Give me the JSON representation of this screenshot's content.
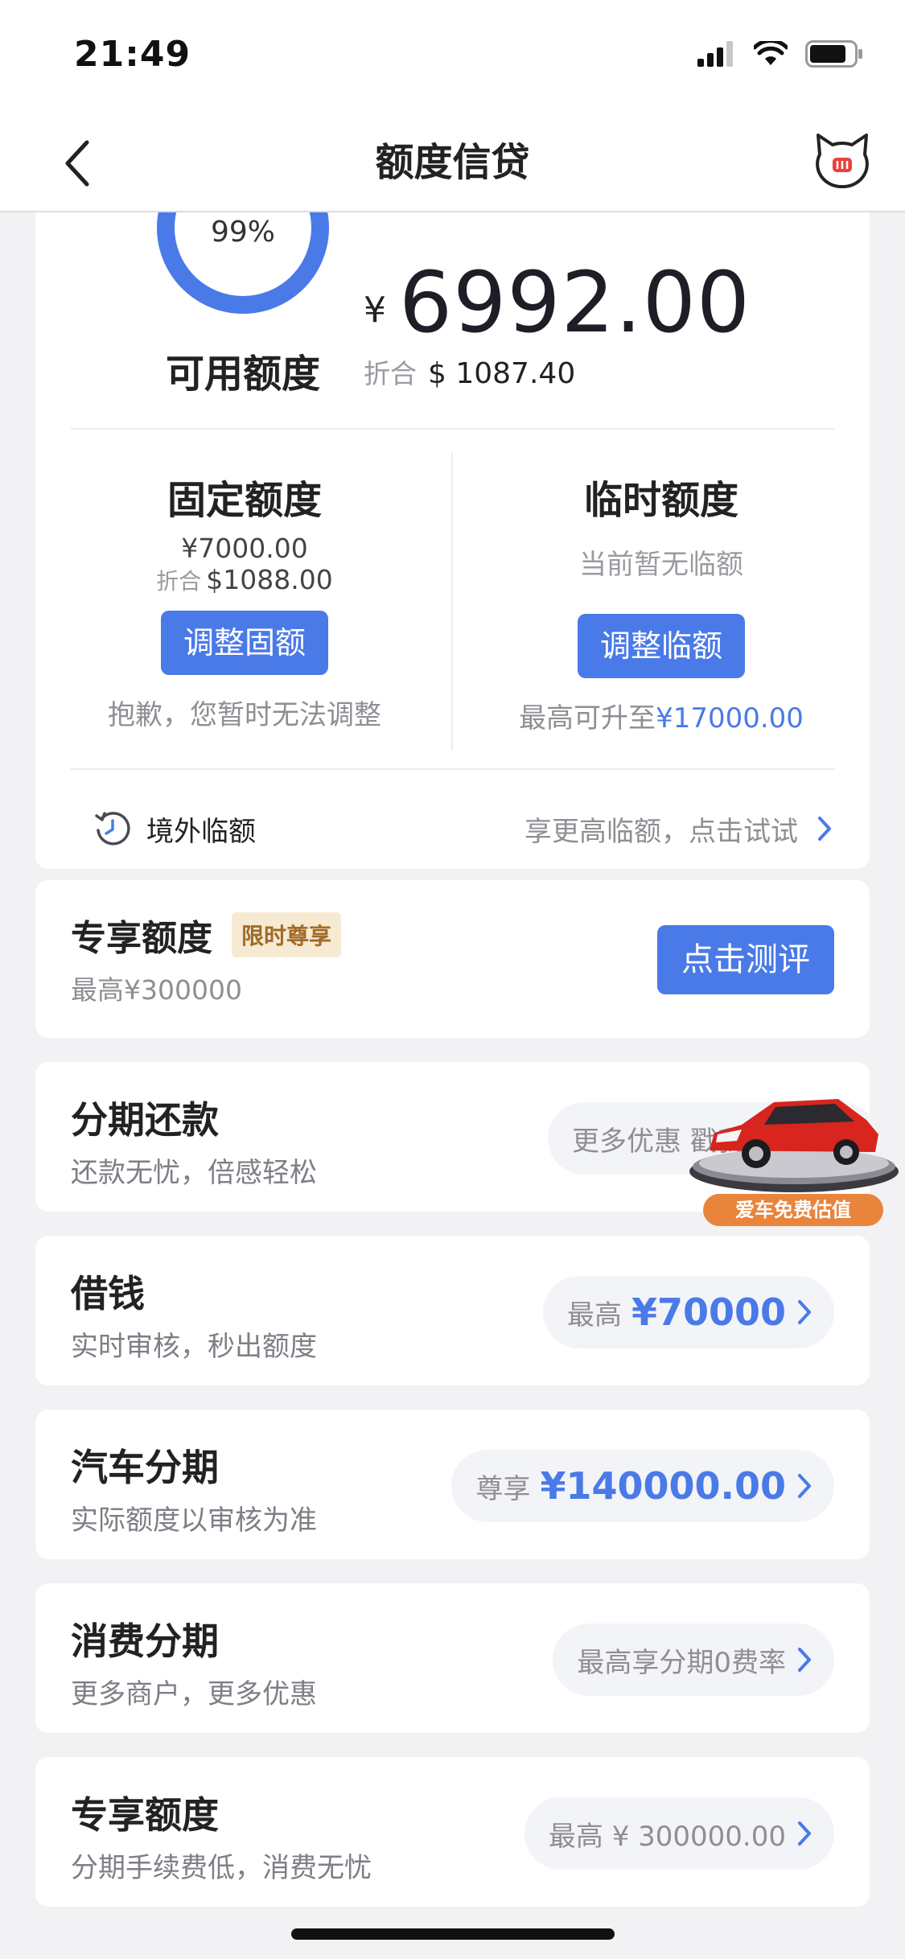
{
  "status_bar": {
    "time": "21:49"
  },
  "nav": {
    "title": "额度信贷"
  },
  "credit": {
    "ring_percent_label": "99%",
    "ring_fraction": 0.99,
    "available_label": "可用额度",
    "currency_symbol": "¥",
    "available_amount": "6992.00",
    "usd_prefix": "折合",
    "usd_amount": "$ 1087.40",
    "fixed": {
      "title": "固定额度",
      "cny": "¥7000.00",
      "usd_prefix": "折合",
      "usd": "$1088.00",
      "button": "调整固额",
      "note": "抱歉，您暂时无法调整"
    },
    "temp": {
      "title": "临时额度",
      "status": "当前暂无临额",
      "button": "调整临额",
      "note_prefix": "最高可升至",
      "note_amount": "¥17000.00"
    },
    "abroad": {
      "label": "境外临额",
      "link": "享更高临额，点击试试"
    }
  },
  "exclusive": {
    "title": "专享额度",
    "badge": "限时尊享",
    "sub": "最高¥300000",
    "button": "点击测评"
  },
  "list": [
    {
      "title": "分期还款",
      "sub": "还款无忧，倍感轻松",
      "pill_text": "更多优惠 戳我"
    },
    {
      "title": "借钱",
      "sub": "实时审核，秒出额度",
      "pill_prefix": "最高",
      "pill_amount": "¥70000"
    },
    {
      "title": "汽车分期",
      "sub": "实际额度以审核为准",
      "pill_prefix": "尊享",
      "pill_amount": "¥140000.00"
    },
    {
      "title": "消费分期",
      "sub": "更多商户，更多优惠",
      "pill_text": "最高享分期0费率"
    },
    {
      "title": "专享额度",
      "sub": "分期手续费低，消费无忧",
      "pill_text": "最高 ¥ 300000.00"
    }
  ],
  "car_promo": {
    "label": "爱车免费估值"
  },
  "colors": {
    "accent": "#4a7ae8",
    "badge_bg": "#f6ead2",
    "badge_text": "#a06b28",
    "promo": "#e8843c"
  }
}
